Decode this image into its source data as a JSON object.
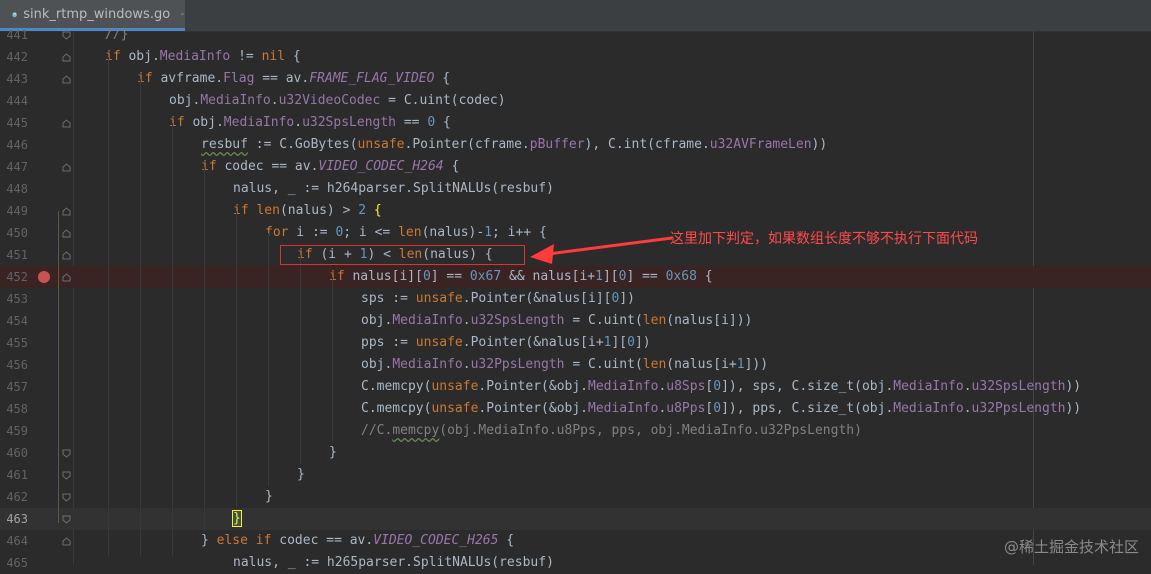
{
  "tab": {
    "filename": "sink_rtmp_windows.go"
  },
  "lines": [
    {
      "num": "441"
    },
    {
      "num": "442"
    },
    {
      "num": "443"
    },
    {
      "num": "444"
    },
    {
      "num": "445"
    },
    {
      "num": "446"
    },
    {
      "num": "447"
    },
    {
      "num": "448"
    },
    {
      "num": "449"
    },
    {
      "num": "450"
    },
    {
      "num": "451"
    },
    {
      "num": "452"
    },
    {
      "num": "453"
    },
    {
      "num": "454"
    },
    {
      "num": "455"
    },
    {
      "num": "456"
    },
    {
      "num": "457"
    },
    {
      "num": "458"
    },
    {
      "num": "459"
    },
    {
      "num": "460"
    },
    {
      "num": "461"
    },
    {
      "num": "462"
    },
    {
      "num": "463"
    },
    {
      "num": "464"
    },
    {
      "num": "465"
    }
  ],
  "annotation": "这里加下判定，如果数组长度不够不执行下面代码",
  "watermark": "@稀土掘金技术社区",
  "colors": {
    "annotation": "#ff4a4a",
    "breakpoint": "#c75450",
    "editor_bg": "#2b2b2b"
  }
}
